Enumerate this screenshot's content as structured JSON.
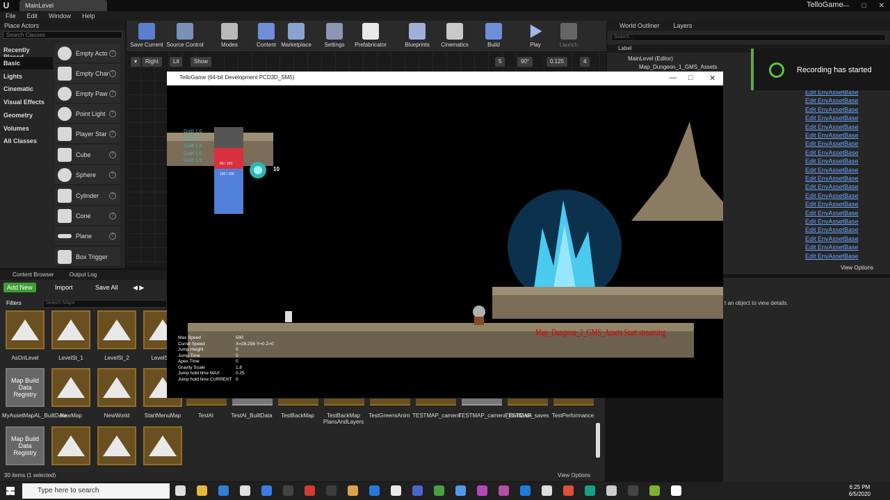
{
  "window": {
    "tab": "MainLevel",
    "app_name": "TelloGame"
  },
  "menu": [
    "File",
    "Edit",
    "Window",
    "Help"
  ],
  "place_actors": {
    "title": "Place Actors",
    "search_placeholder": "Search Classes",
    "categories": [
      "Recently Placed",
      "Basic",
      "Lights",
      "Cinematic",
      "Visual Effects",
      "Geometry",
      "Volumes",
      "All Classes"
    ],
    "items": [
      "Empty Acto",
      "Empty Char",
      "Empty Paw",
      "Point Light",
      "Player Star",
      "Cube",
      "Sphere",
      "Cylinder",
      "Cone",
      "Plane",
      "Box Trigger"
    ]
  },
  "toolbar": {
    "buttons": [
      "Save Current",
      "Source Control",
      "Modes",
      "Content",
      "Marketplace",
      "Settings",
      "Prefabricator",
      "Blueprints",
      "Cinematics",
      "Build",
      "Play",
      "Launch"
    ]
  },
  "viewport": {
    "buttons": [
      "Right",
      "Lit",
      "Show"
    ],
    "snap": [
      "5",
      "90°",
      "0.125",
      "4"
    ]
  },
  "outliner": {
    "tabs": [
      "World Outliner",
      "Layers"
    ],
    "search_placeholder": "Search...",
    "column": "Label",
    "rows": [
      "MainLevel (Editor)",
      "Map_Dungeon_1_GMS_Assets"
    ],
    "links": [
      "Edit EnvAssetBase",
      "Edit EnvAssetBase",
      "Edit EnvAssetBase",
      "Edit EnvAssetBase",
      "Edit EnvAssetBase",
      "Edit EnvAssetBase",
      "Edit EnvAssetBase",
      "Edit EnvAssetBase",
      "Edit EnvAssetBase",
      "Edit EnvAssetBase",
      "Edit EnvAssetBase",
      "Edit EnvAssetBase",
      "Edit EnvAssetBase",
      "Edit EnvAssetBase",
      "Edit EnvAssetBase",
      "Edit EnvAssetBase",
      "Edit EnvAssetBase",
      "Edit EnvAssetBase",
      "Edit EnvAssetBase",
      "Edit EnvAssetBase"
    ],
    "view_options": "View Options"
  },
  "notification": "Recording has started",
  "details": {
    "hint": "t an object to view details."
  },
  "content_browser": {
    "tabs": [
      "Content Browser",
      "Output Log"
    ],
    "add_new": "Add New",
    "import": "Import",
    "save_all": "Save All",
    "filters": "Filters",
    "search_placeholder": "Search Maps",
    "row1": [
      "AsOriLevel",
      "LevelSt_1",
      "LevelSt_2",
      "LevelSt..."
    ],
    "row2": [
      "MyAssetMapAL_BuiltData",
      "NewMap",
      "NewWorld",
      "StartMenuMap",
      "TestAI",
      "TestAI_BuiltData",
      "TestBackMap",
      "TestBackMap PlansAndLayers",
      "TestGreensAnim",
      "TESTMAP_camera",
      "TESTMAP_camera_BuiltData",
      "TESTMAP_saves",
      "TestPerformance"
    ],
    "registry_label": "Map Build Data Registry",
    "status": "30 items (1 selected)",
    "view_options": "View Options"
  },
  "game": {
    "title": "TelloGame (64-bit Development PCD3D_SM5)",
    "gold_rows": [
      "Gold  1.0",
      "Gold  1.0",
      "Gold  1.0",
      "Gold  1.0",
      "Gold  1.0"
    ],
    "hp": "60 / 100",
    "mp": "100 / 100",
    "orb_count": "10",
    "stream_text": "Map_Dungeon_2_GMS_Assets Start streaming",
    "stats": [
      {
        "label": "Max Speed",
        "value": "500"
      },
      {
        "label": "Curret Speed",
        "value": "X=28.256 Y=0 Z=0"
      },
      {
        "label": "Jump Height",
        "value": "0"
      },
      {
        "label": "Jump Time",
        "value": "0"
      },
      {
        "label": "Apex Time",
        "value": "0"
      },
      {
        "label": "Gravity Scale",
        "value": "1.8"
      },
      {
        "label": "Jump hold time MAX",
        "value": "0.25"
      },
      {
        "label": "Jump hold time CURRENT",
        "value": "0"
      }
    ]
  },
  "taskbar": {
    "search": "Type here to search",
    "time": "6:25 PM",
    "date": "6/5/2020"
  }
}
